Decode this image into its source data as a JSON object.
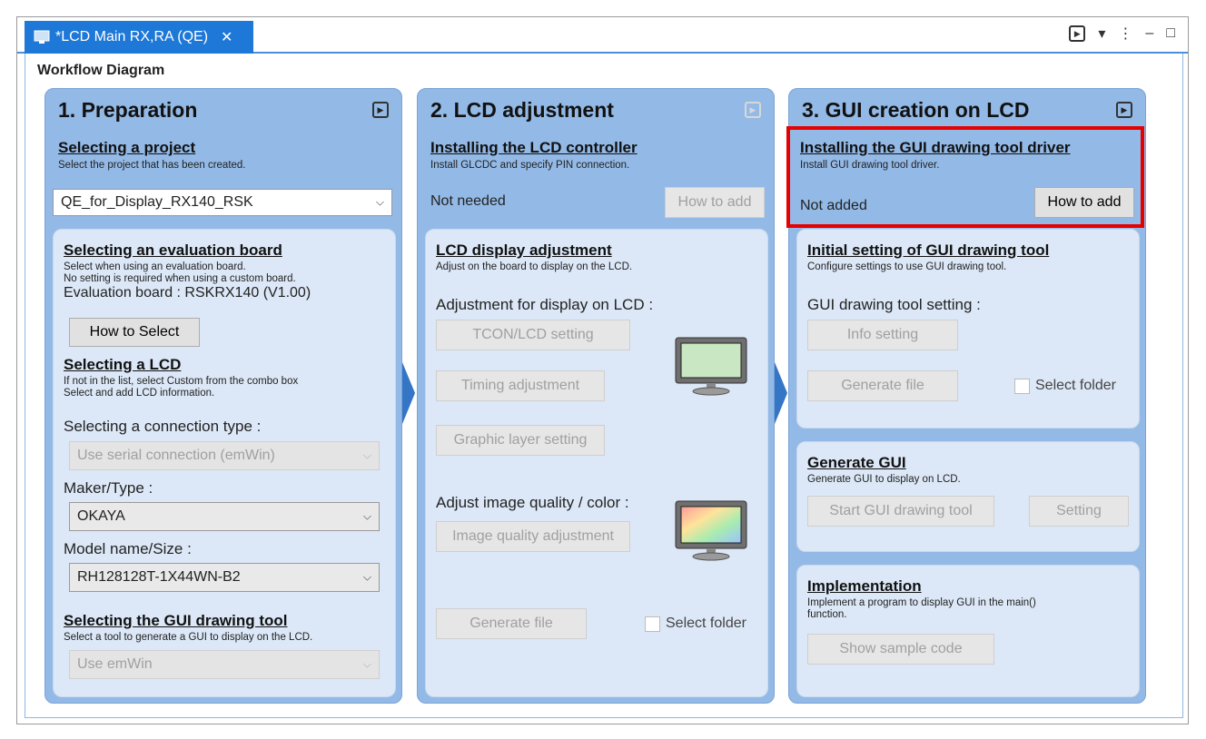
{
  "tab": {
    "title": "*LCD Main RX,RA (QE)",
    "close": "✕"
  },
  "window_icons": {
    "run": "▶",
    "dropdown": "▾",
    "more": "⋮",
    "minimize": "–",
    "maximize": "□"
  },
  "panel_title": "Workflow Diagram",
  "col1": {
    "title": "1. Preparation",
    "project": {
      "title": "Selecting a project",
      "desc": "Select the project that has been created.",
      "value": "QE_for_Display_RX140_RSK"
    },
    "eval": {
      "title": "Selecting an evaluation board",
      "desc1": "Select when using an evaluation board.",
      "desc2": "No setting is required when using a custom board.",
      "board": "Evaluation board : RSKRX140 (V1.00)",
      "button": "How to Select"
    },
    "lcd": {
      "title": "Selecting a LCD",
      "desc1": "If not in the list, select Custom from the combo box",
      "desc2": "Select and add LCD information.",
      "conn_label": "Selecting a connection type :",
      "conn_value": "Use serial connection (emWin)",
      "maker_label": "Maker/Type :",
      "maker_value": "OKAYA",
      "model_label": "Model name/Size :",
      "model_value": "RH128128T-1X44WN-B2"
    },
    "gui": {
      "title": "Selecting the GUI drawing tool",
      "desc": "Select a tool to generate a GUI to display on the LCD.",
      "value": "Use emWin"
    }
  },
  "col2": {
    "title": "2. LCD adjustment",
    "controller": {
      "title": "Installing the LCD controller",
      "desc": "Install GLCDC and specify PIN connection.",
      "status": "Not needed",
      "button": "How to add"
    },
    "display": {
      "title": "LCD display adjustment",
      "desc": "Adjust on the board to display on the LCD.",
      "label1": "Adjustment for display on LCD :",
      "btn_tcon": "TCON/LCD setting",
      "btn_timing": "Timing adjustment",
      "btn_layer": "Graphic layer setting",
      "label2": "Adjust image quality / color :",
      "btn_quality": "Image quality adjustment",
      "btn_generate": "Generate file",
      "select_folder": "Select folder"
    }
  },
  "col3": {
    "title": "3. GUI creation on LCD",
    "driver": {
      "title": "Installing the GUI drawing tool driver",
      "desc": "Install GUI drawing tool driver.",
      "status": "Not added",
      "button": "How to add"
    },
    "initial": {
      "title": "Initial setting of GUI drawing tool",
      "desc": "Configure settings to use GUI drawing tool.",
      "label": "GUI drawing tool setting :",
      "btn_info": "Info setting",
      "btn_generate": "Generate file",
      "select_folder": "Select folder"
    },
    "generate": {
      "title": "Generate GUI",
      "desc": "Generate GUI to display on LCD.",
      "btn_start": "Start GUI drawing tool",
      "btn_setting": "Setting"
    },
    "impl": {
      "title": "Implementation",
      "desc1": "Implement a program to display GUI in the main()",
      "desc2": "function.",
      "btn_sample": "Show sample code"
    }
  }
}
